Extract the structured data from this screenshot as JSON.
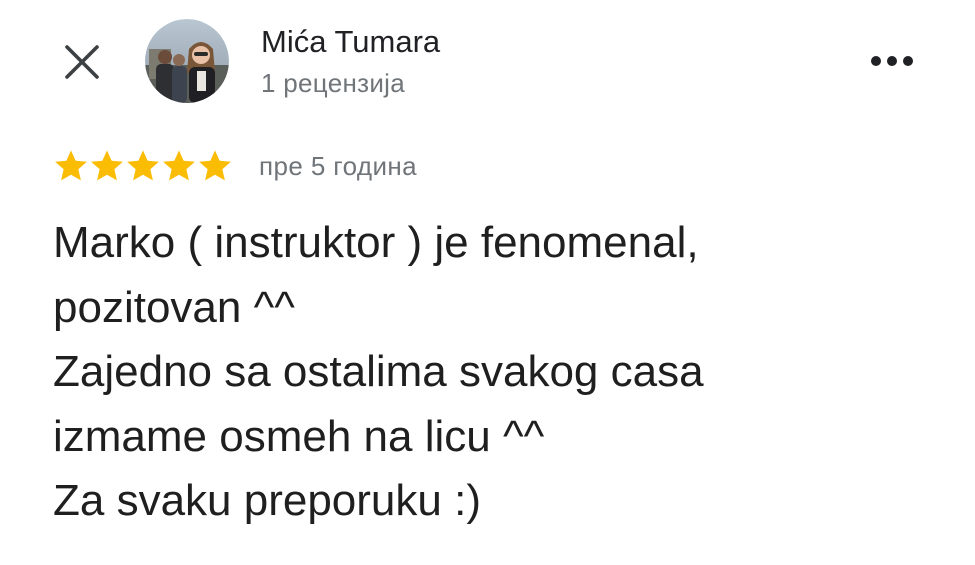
{
  "header": {
    "close_icon": "close-icon",
    "more_icon": "more-horizontal-icon",
    "reviewer_name": "Mića Tumara",
    "review_count": "1 рецензија"
  },
  "rating": {
    "stars": 5,
    "max_stars": 5,
    "star_color": "#fbbc04",
    "time": "пре 5 година"
  },
  "review": {
    "lines": [
      "Marko ( instruktor ) je fenomenal,",
      "pozitovan ^^",
      "Zajedno sa ostalima svakog casa",
      "izmame osmeh na licu ^^",
      "Za svaku preporuku :)"
    ]
  }
}
